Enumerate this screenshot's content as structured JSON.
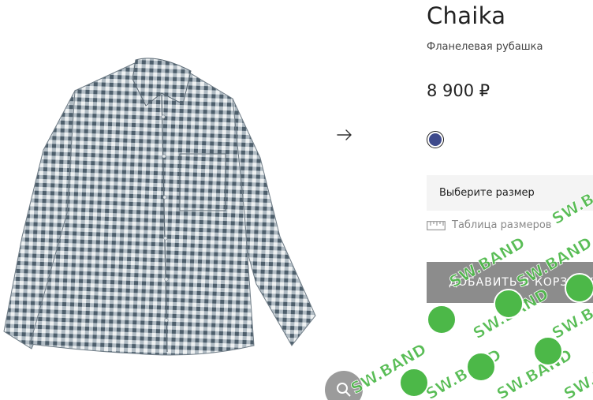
{
  "product": {
    "title": "Chaika",
    "subtitle": "Фланелевая рубашка",
    "price": "8 900 ₽",
    "color_hex": "#3e4a8c"
  },
  "size_select": {
    "label": "Выберите размер"
  },
  "size_table_link": {
    "label": "Таблица размеров"
  },
  "cart": {
    "button_label": "ДОБАВИТЬ В КОРЗИНУ"
  },
  "icons": {
    "gallery_next": "arrow-right-icon",
    "ruler": "ruler-icon",
    "zoom": "zoom-icon"
  },
  "watermark": {
    "text": "SW.BAND"
  },
  "colors": {
    "button_bg": "#8c8c8c",
    "select_bg": "#f4f4f4",
    "watermark_green": "#4cb848"
  }
}
